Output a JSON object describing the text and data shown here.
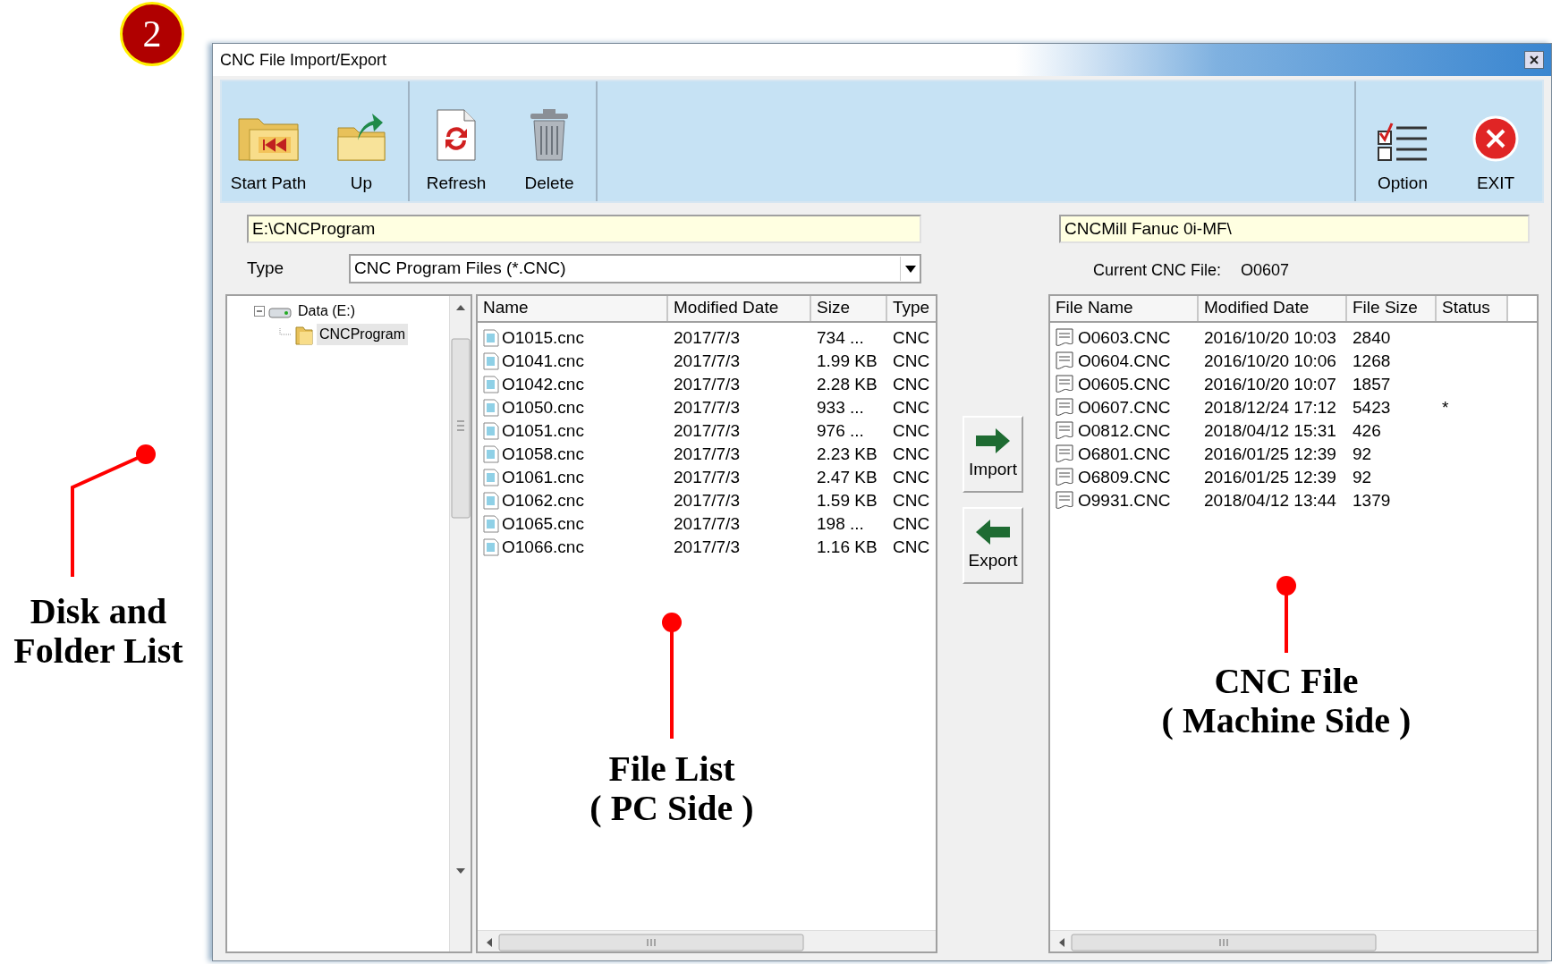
{
  "step_badge": "2",
  "window": {
    "title": "CNC File Import/Export"
  },
  "toolbar": {
    "left_groups": [
      [
        {
          "label": "Start Path",
          "kind": "start"
        },
        {
          "label": "Up",
          "kind": "up"
        }
      ],
      [
        {
          "label": "Refresh",
          "kind": "refresh"
        },
        {
          "label": "Delete",
          "kind": "delete"
        }
      ]
    ],
    "right_groups": [
      [
        {
          "label": "Option",
          "kind": "option"
        },
        {
          "label": "EXIT",
          "kind": "exit"
        }
      ]
    ]
  },
  "pc_path": "E:\\CNCProgram",
  "type_filter": {
    "label": "Type",
    "value": "CNC Program Files (*.CNC)"
  },
  "tree": [
    {
      "label": "Data (E:)",
      "kind": "drive",
      "expanded": true,
      "selected": false,
      "children": [
        {
          "label": "CNCProgram",
          "kind": "folder",
          "selected": true
        }
      ]
    }
  ],
  "pc_files": {
    "columns": [
      "Name",
      "Modified Date",
      "Size",
      "Type"
    ],
    "rows": [
      [
        "O1015.cnc",
        "2017/7/3",
        "734 ...",
        "CNC"
      ],
      [
        "O1041.cnc",
        "2017/7/3",
        "1.99 KB",
        "CNC"
      ],
      [
        "O1042.cnc",
        "2017/7/3",
        "2.28 KB",
        "CNC"
      ],
      [
        "O1050.cnc",
        "2017/7/3",
        "933 ...",
        "CNC"
      ],
      [
        "O1051.cnc",
        "2017/7/3",
        "976 ...",
        "CNC"
      ],
      [
        "O1058.cnc",
        "2017/7/3",
        "2.23 KB",
        "CNC"
      ],
      [
        "O1061.cnc",
        "2017/7/3",
        "2.47 KB",
        "CNC"
      ],
      [
        "O1062.cnc",
        "2017/7/3",
        "1.59 KB",
        "CNC"
      ],
      [
        "O1065.cnc",
        "2017/7/3",
        "198 ...",
        "CNC"
      ],
      [
        "O1066.cnc",
        "2017/7/3",
        "1.16 KB",
        "CNC"
      ]
    ]
  },
  "transfer_buttons": [
    {
      "label": "Import",
      "kind": "right"
    },
    {
      "label": "Export",
      "kind": "left"
    }
  ],
  "cnc_path": "CNCMill Fanuc 0i-MF\\",
  "current_file": {
    "label": "Current CNC File:",
    "value": "O0607"
  },
  "cnc_files": {
    "columns": [
      "File Name",
      "Modified Date",
      "File Size",
      "Status"
    ],
    "rows": [
      [
        "O0603.CNC",
        "2016/10/20 10:03",
        "2840"
      ],
      [
        "O0604.CNC",
        "2016/10/20 10:06",
        "1268"
      ],
      [
        "O0605.CNC",
        "2016/10/20 10:07",
        "1857"
      ],
      [
        "O0607.CNC",
        "2018/12/24 17:12",
        "5423",
        "*"
      ],
      [
        "O0812.CNC",
        "2018/04/12 15:31",
        "426"
      ],
      [
        "O6801.CNC",
        "2016/01/25 12:39",
        "92"
      ],
      [
        "O6809.CNC",
        "2016/01/25 12:39",
        "92"
      ],
      [
        "O9931.CNC",
        "2018/04/12 13:44",
        "1379"
      ]
    ]
  },
  "annotations": [
    {
      "text": "Disk and\nFolder List"
    },
    {
      "text": "File List\n( PC Side )"
    },
    {
      "text": "CNC File\n( Machine Side )"
    }
  ]
}
